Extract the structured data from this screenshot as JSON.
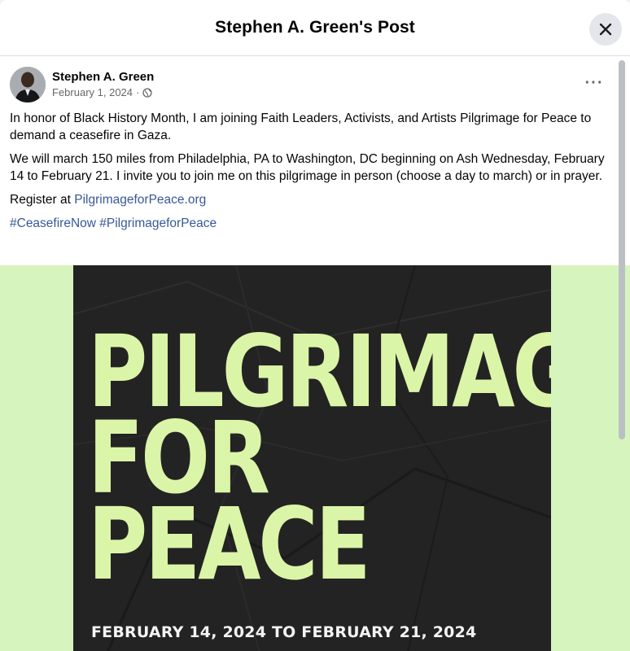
{
  "dialog": {
    "title": "Stephen A. Green's Post",
    "close_icon": "close-icon"
  },
  "post": {
    "author": "Stephen A. Green",
    "date": "February 1, 2024",
    "separator": "·",
    "audience_icon": "globe-icon",
    "more_label": "···",
    "paragraph1": "In honor of Black History Month, I am joining Faith Leaders, Activists, and Artists Pilgrimage for Peace to demand a ceasefire in Gaza.",
    "paragraph2": "We will march 150 miles from Philadelphia, PA to Washington, DC beginning on Ash Wednesday, February 14 to February 21. I invite you to join me on this pilgrimage in person (choose a day to march) or in prayer.",
    "register_prefix": "Register at ",
    "register_link": "PilgrimageforPeace.org",
    "hashtags": [
      "#CeasefireNow",
      "#PilgrimageforPeace"
    ]
  },
  "media": {
    "title_lines": [
      "PILGRIMAGE",
      "FOR",
      "PEACE"
    ],
    "dates": "FEBRUARY 14, 2024 TO FEBRUARY 21, 2024",
    "colors": {
      "background": "#d6f5be",
      "poster": "#232323",
      "headline": "#dbf5a8"
    }
  }
}
